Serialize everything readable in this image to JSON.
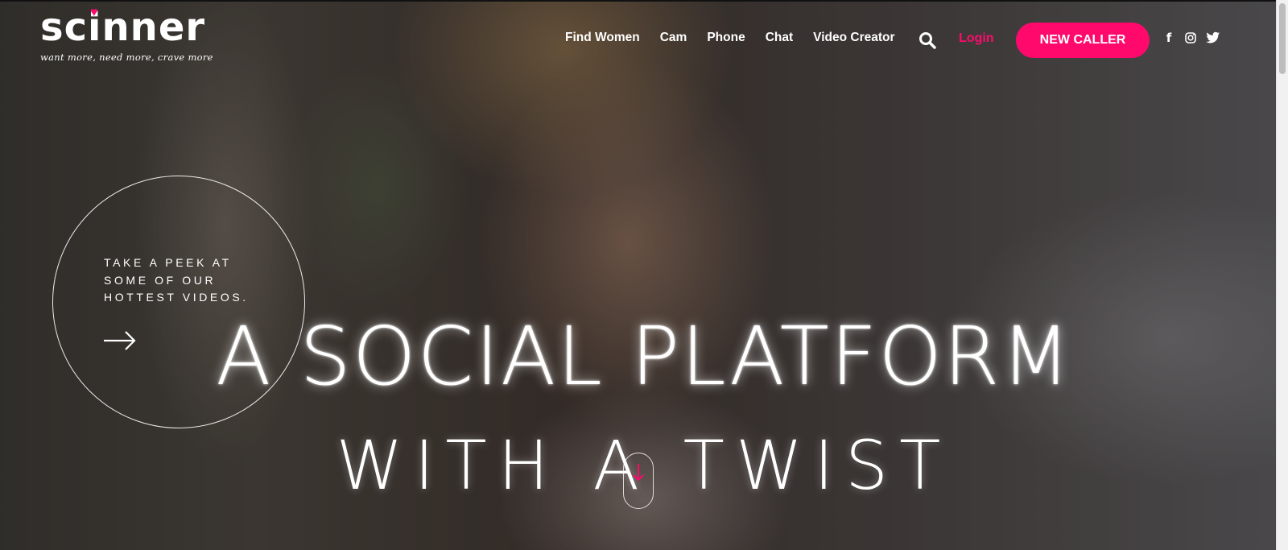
{
  "brand": {
    "name": "scinner",
    "tagline": "want more, need more, crave more",
    "heart_icon": "heart-icon",
    "accent_color": "#ff0a6c"
  },
  "nav": {
    "items": [
      {
        "label": "Find Women"
      },
      {
        "label": "Cam"
      },
      {
        "label": "Phone"
      },
      {
        "label": "Chat"
      },
      {
        "label": "Video Creator"
      }
    ],
    "search_icon": "search-icon",
    "login_label": "Login",
    "cta_label": "NEW CALLER",
    "social_icons": [
      "facebook-icon",
      "instagram-icon",
      "twitter-icon"
    ]
  },
  "hero": {
    "peek_text": "TAKE A PEEK AT SOME OF OUR HOTTEST VIDEOS.",
    "peek_arrow_icon": "arrow-right-icon",
    "headline_line1": "A SOCIAL PLATFORM",
    "headline_line2": "WITH A TWIST",
    "scroll_icon": "arrow-down-icon"
  }
}
